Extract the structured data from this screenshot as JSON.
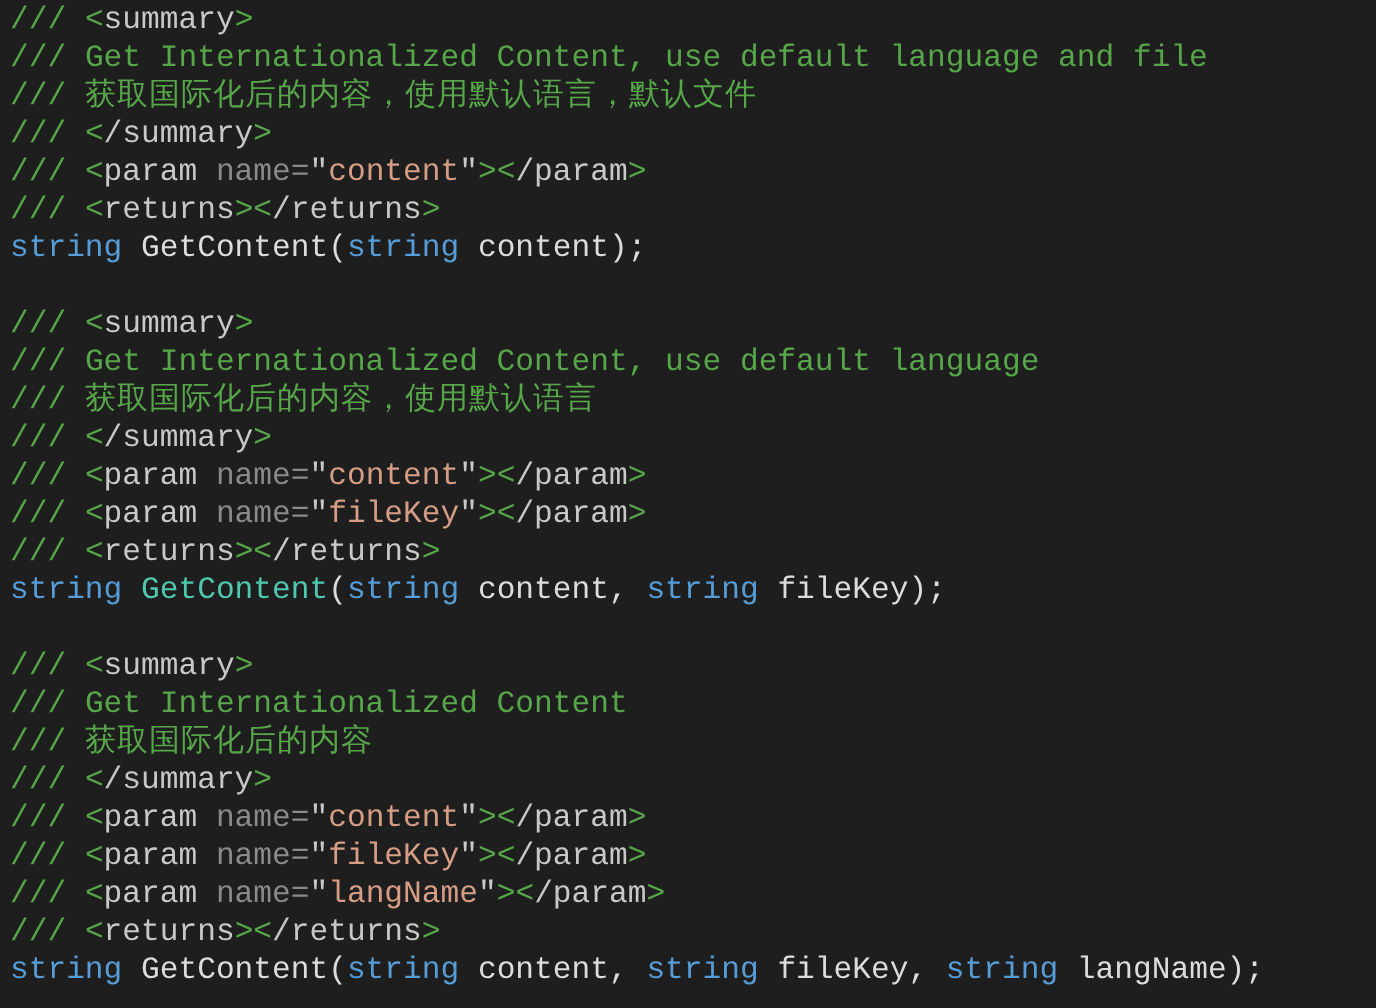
{
  "editor": {
    "blocks": [
      {
        "lines": [
          [
            {
              "text": "/// ",
              "kind": "mark"
            },
            {
              "text": "<",
              "kind": "punct"
            },
            {
              "text": "summary",
              "kind": "tag"
            },
            {
              "text": ">",
              "kind": "punct"
            }
          ],
          [
            {
              "text": "/// ",
              "kind": "mark"
            },
            {
              "text": "Get Internationalized Content, use default language and file",
              "kind": "comment"
            }
          ],
          [
            {
              "text": "/// ",
              "kind": "mark"
            },
            {
              "text": "获取国际化后的内容，使用默认语言，默认文件",
              "kind": "comment"
            }
          ],
          [
            {
              "text": "/// ",
              "kind": "mark"
            },
            {
              "text": "<",
              "kind": "punct"
            },
            {
              "text": "/summary",
              "kind": "tag"
            },
            {
              "text": ">",
              "kind": "punct"
            }
          ],
          [
            {
              "text": "/// ",
              "kind": "mark"
            },
            {
              "text": "<",
              "kind": "punct"
            },
            {
              "text": "param ",
              "kind": "tag"
            },
            {
              "text": "name=",
              "kind": "attr"
            },
            {
              "text": "\"",
              "kind": "quote"
            },
            {
              "text": "content",
              "kind": "value"
            },
            {
              "text": "\"",
              "kind": "quote"
            },
            {
              "text": "><",
              "kind": "punct"
            },
            {
              "text": "/param",
              "kind": "tag"
            },
            {
              "text": ">",
              "kind": "punct"
            }
          ],
          [
            {
              "text": "/// ",
              "kind": "mark"
            },
            {
              "text": "<",
              "kind": "punct"
            },
            {
              "text": "returns",
              "kind": "tag"
            },
            {
              "text": "><",
              "kind": "punct"
            },
            {
              "text": "/returns",
              "kind": "tag"
            },
            {
              "text": ">",
              "kind": "punct"
            }
          ],
          [
            {
              "text": "string",
              "kind": "keyword"
            },
            {
              "text": " GetContent(",
              "kind": "plain"
            },
            {
              "text": "string",
              "kind": "keyword"
            },
            {
              "text": " content);",
              "kind": "plain"
            }
          ]
        ]
      },
      {
        "lines": [
          [
            {
              "text": "/// ",
              "kind": "mark"
            },
            {
              "text": "<",
              "kind": "punct"
            },
            {
              "text": "summary",
              "kind": "tag"
            },
            {
              "text": ">",
              "kind": "punct"
            }
          ],
          [
            {
              "text": "/// ",
              "kind": "mark"
            },
            {
              "text": "Get Internationalized Content, use default language",
              "kind": "comment"
            }
          ],
          [
            {
              "text": "/// ",
              "kind": "mark"
            },
            {
              "text": "获取国际化后的内容，使用默认语言",
              "kind": "comment"
            }
          ],
          [
            {
              "text": "/// ",
              "kind": "mark"
            },
            {
              "text": "<",
              "kind": "punct"
            },
            {
              "text": "/summary",
              "kind": "tag"
            },
            {
              "text": ">",
              "kind": "punct"
            }
          ],
          [
            {
              "text": "/// ",
              "kind": "mark"
            },
            {
              "text": "<",
              "kind": "punct"
            },
            {
              "text": "param ",
              "kind": "tag"
            },
            {
              "text": "name=",
              "kind": "attr"
            },
            {
              "text": "\"",
              "kind": "quote"
            },
            {
              "text": "content",
              "kind": "value"
            },
            {
              "text": "\"",
              "kind": "quote"
            },
            {
              "text": "><",
              "kind": "punct"
            },
            {
              "text": "/param",
              "kind": "tag"
            },
            {
              "text": ">",
              "kind": "punct"
            }
          ],
          [
            {
              "text": "/// ",
              "kind": "mark"
            },
            {
              "text": "<",
              "kind": "punct"
            },
            {
              "text": "param ",
              "kind": "tag"
            },
            {
              "text": "name=",
              "kind": "attr"
            },
            {
              "text": "\"",
              "kind": "quote"
            },
            {
              "text": "fileKey",
              "kind": "value"
            },
            {
              "text": "\"",
              "kind": "quote"
            },
            {
              "text": "><",
              "kind": "punct"
            },
            {
              "text": "/param",
              "kind": "tag"
            },
            {
              "text": ">",
              "kind": "punct"
            }
          ],
          [
            {
              "text": "/// ",
              "kind": "mark"
            },
            {
              "text": "<",
              "kind": "punct"
            },
            {
              "text": "returns",
              "kind": "tag"
            },
            {
              "text": "><",
              "kind": "punct"
            },
            {
              "text": "/returns",
              "kind": "tag"
            },
            {
              "text": ">",
              "kind": "punct"
            }
          ],
          [
            {
              "text": "string",
              "kind": "keyword"
            },
            {
              "text": " GetContent",
              "kind": "method"
            },
            {
              "text": "(",
              "kind": "plain"
            },
            {
              "text": "string",
              "kind": "keyword"
            },
            {
              "text": " content, ",
              "kind": "plain"
            },
            {
              "text": "string",
              "kind": "keyword"
            },
            {
              "text": " fileKey);",
              "kind": "plain"
            }
          ]
        ]
      },
      {
        "lines": [
          [
            {
              "text": "/// ",
              "kind": "mark"
            },
            {
              "text": "<",
              "kind": "punct"
            },
            {
              "text": "summary",
              "kind": "tag"
            },
            {
              "text": ">",
              "kind": "punct"
            }
          ],
          [
            {
              "text": "/// ",
              "kind": "mark"
            },
            {
              "text": "Get Internationalized Content",
              "kind": "comment"
            }
          ],
          [
            {
              "text": "/// ",
              "kind": "mark"
            },
            {
              "text": "获取国际化后的内容",
              "kind": "comment"
            }
          ],
          [
            {
              "text": "/// ",
              "kind": "mark"
            },
            {
              "text": "<",
              "kind": "punct"
            },
            {
              "text": "/summary",
              "kind": "tag"
            },
            {
              "text": ">",
              "kind": "punct"
            }
          ],
          [
            {
              "text": "/// ",
              "kind": "mark"
            },
            {
              "text": "<",
              "kind": "punct"
            },
            {
              "text": "param ",
              "kind": "tag"
            },
            {
              "text": "name=",
              "kind": "attr"
            },
            {
              "text": "\"",
              "kind": "quote"
            },
            {
              "text": "content",
              "kind": "value"
            },
            {
              "text": "\"",
              "kind": "quote"
            },
            {
              "text": "><",
              "kind": "punct"
            },
            {
              "text": "/param",
              "kind": "tag"
            },
            {
              "text": ">",
              "kind": "punct"
            }
          ],
          [
            {
              "text": "/// ",
              "kind": "mark"
            },
            {
              "text": "<",
              "kind": "punct"
            },
            {
              "text": "param ",
              "kind": "tag"
            },
            {
              "text": "name=",
              "kind": "attr"
            },
            {
              "text": "\"",
              "kind": "quote"
            },
            {
              "text": "fileKey",
              "kind": "value"
            },
            {
              "text": "\"",
              "kind": "quote"
            },
            {
              "text": "><",
              "kind": "punct"
            },
            {
              "text": "/param",
              "kind": "tag"
            },
            {
              "text": ">",
              "kind": "punct"
            }
          ],
          [
            {
              "text": "/// ",
              "kind": "mark"
            },
            {
              "text": "<",
              "kind": "punct"
            },
            {
              "text": "param ",
              "kind": "tag"
            },
            {
              "text": "name=",
              "kind": "attr"
            },
            {
              "text": "\"",
              "kind": "quote"
            },
            {
              "text": "langName",
              "kind": "value"
            },
            {
              "text": "\"",
              "kind": "quote"
            },
            {
              "text": "><",
              "kind": "punct"
            },
            {
              "text": "/param",
              "kind": "tag"
            },
            {
              "text": ">",
              "kind": "punct"
            }
          ],
          [
            {
              "text": "/// ",
              "kind": "mark"
            },
            {
              "text": "<",
              "kind": "punct"
            },
            {
              "text": "returns",
              "kind": "tag"
            },
            {
              "text": "><",
              "kind": "punct"
            },
            {
              "text": "/returns",
              "kind": "tag"
            },
            {
              "text": ">",
              "kind": "punct"
            }
          ],
          [
            {
              "text": "string",
              "kind": "keyword"
            },
            {
              "text": " GetContent(",
              "kind": "plain"
            },
            {
              "text": "string",
              "kind": "keyword"
            },
            {
              "text": " content, ",
              "kind": "plain"
            },
            {
              "text": "string",
              "kind": "keyword"
            },
            {
              "text": " fileKey, ",
              "kind": "plain"
            },
            {
              "text": "string",
              "kind": "keyword"
            },
            {
              "text": " langName);",
              "kind": "plain"
            }
          ]
        ]
      }
    ]
  }
}
